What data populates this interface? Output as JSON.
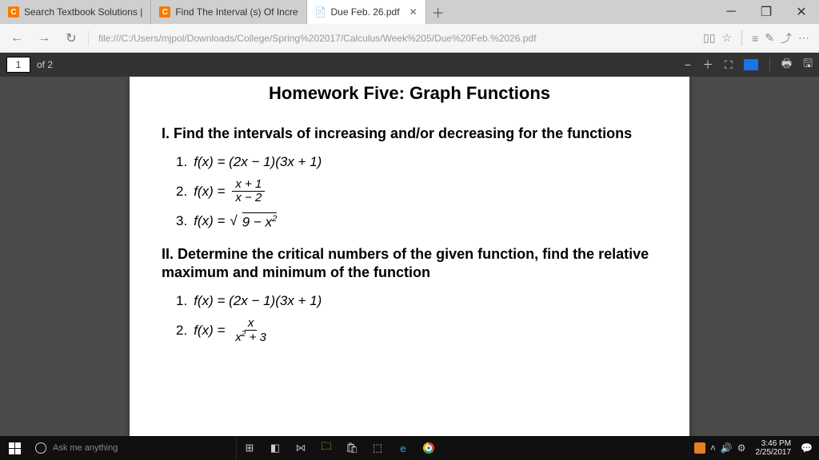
{
  "tabs": {
    "t0": "Search Textbook Solutions |",
    "t1": "Find The Interval (s) Of Incre",
    "t2": "Due Feb. 26.pdf"
  },
  "nav": {
    "url": "file:///C:/Users/mjpol/Downloads/College/Spring%202017/Calculus/Week%205/Due%20Feb.%2026.pdf"
  },
  "pdf": {
    "page": "1",
    "of": "of 2"
  },
  "doc": {
    "title": "Homework Five: Graph Functions",
    "sec1": "I. Find the intervals of increasing and/or decreasing for the functions",
    "p1n": "1.",
    "p1": "f(x) = (2x − 1)(3x + 1)",
    "p2n": "2.",
    "p2a": "f(x) =",
    "p2top": "x + 1",
    "p2bot": "x − 2",
    "p3n": "3.",
    "p3a": "f(x) = ",
    "p3root": "9 − x",
    "p3sup": "2",
    "sec2": "II. Determine the critical numbers of the given function, find the relative maximum and minimum of the function",
    "q1n": "1.",
    "q1": "f(x) = (2x − 1)(3x + 1)",
    "q2n": "2.",
    "q2a": "f(x) =",
    "q2top": "x",
    "q2bot": "x",
    "q2sup": "2",
    "q2bot2": " + 3"
  },
  "task": {
    "search": "Ask me anything",
    "time": "3:46 PM",
    "date": "2/25/2017"
  }
}
